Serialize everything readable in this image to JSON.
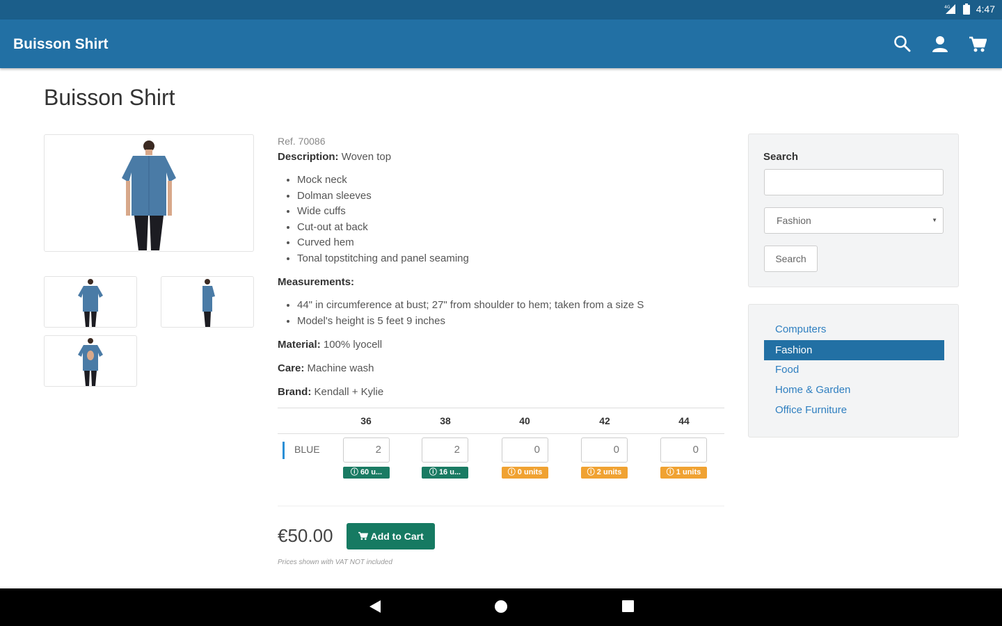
{
  "status_bar": {
    "time": "4:47"
  },
  "app_bar": {
    "title": "Buisson Shirt",
    "actions": [
      "search-icon",
      "account-icon",
      "cart-icon"
    ]
  },
  "page": {
    "title": "Buisson Shirt"
  },
  "product": {
    "ref": "Ref. 70086",
    "description_label": "Description:",
    "description_value": "Woven top",
    "features": [
      "Mock neck",
      "Dolman sleeves",
      "Wide cuffs",
      "Cut-out at back",
      "Curved hem",
      "Tonal topstitching and panel seaming"
    ],
    "measurements_label": "Measurements:",
    "measurements": [
      "44\" in circumference at bust; 27\" from shoulder to hem; taken from a size S",
      "Model's height is 5 feet 9 inches"
    ],
    "material_label": "Material:",
    "material_value": "100% lyocell",
    "care_label": "Care:",
    "care_value": "Machine wash",
    "brand_label": "Brand:",
    "brand_value": "Kendall + Kylie"
  },
  "variants": {
    "sizes": [
      "36",
      "38",
      "40",
      "42",
      "44"
    ],
    "color": "BLUE",
    "quantities": [
      "2",
      "2",
      "0",
      "0",
      "0"
    ],
    "stock": [
      {
        "text": "60 u...",
        "status": "green"
      },
      {
        "text": "16 u...",
        "status": "green"
      },
      {
        "text": "0 units",
        "status": "orange"
      },
      {
        "text": "2 units",
        "status": "orange"
      },
      {
        "text": "1 units",
        "status": "orange"
      }
    ]
  },
  "purchase": {
    "price": "€50.00",
    "add_to_cart": "Add to Cart",
    "note": "Prices shown with VAT NOT included"
  },
  "sidebar": {
    "search_label": "Search",
    "search_value": "",
    "category_selected": "Fashion",
    "search_button": "Search",
    "categories": [
      {
        "label": "Computers",
        "active": false
      },
      {
        "label": "Fashion",
        "active": true
      },
      {
        "label": "Food",
        "active": false
      },
      {
        "label": "Home & Garden",
        "active": false
      },
      {
        "label": "Office Furniture",
        "active": false
      }
    ]
  },
  "colors": {
    "primary": "#2270a4",
    "status_bar": "#1b5e8a",
    "success": "#167a62",
    "warning": "#f0a232",
    "link": "#2f7fc0"
  },
  "nav_bar": [
    "back-icon",
    "home-icon",
    "recents-icon"
  ]
}
